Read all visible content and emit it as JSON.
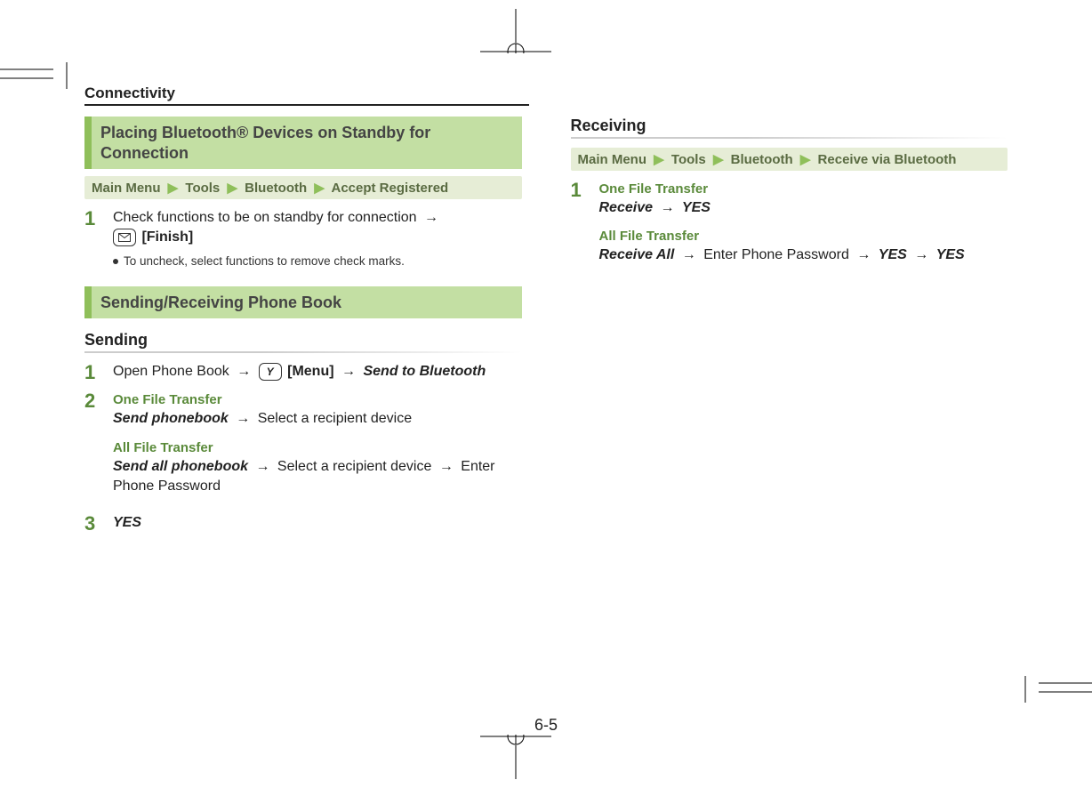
{
  "header": "Connectivity",
  "pageNumber": "6-5",
  "leftCol": {
    "heading1": "Placing Bluetooth® Devices on Standby for Connection",
    "nav1": {
      "root": "Main Menu",
      "items": [
        "Tools",
        "Bluetooth",
        "Accept Registered"
      ]
    },
    "step1": {
      "num": "1",
      "text1": "Check functions to be on standby for connection",
      "finish": "[Finish]",
      "note": "To uncheck, select functions to remove check marks."
    },
    "heading2": "Sending/Receiving Phone Book",
    "sendingTitle": "Sending",
    "sendStep1": {
      "num": "1",
      "text": "Open Phone Book",
      "menuLabel": "[Menu]",
      "sendTo": "Send to Bluetooth"
    },
    "sendStep2": {
      "num": "2",
      "oneFileLabel": "One File Transfer",
      "oneFileAction": "Send phonebook",
      "oneFileRest": "Select a recipient device",
      "allFileLabel": "All File Transfer",
      "allFileAction": "Send all phonebook",
      "allFileRest1": "Select a recipient device",
      "allFileRest2": "Enter Phone Password"
    },
    "sendStep3": {
      "num": "3",
      "yes": "YES"
    }
  },
  "rightCol": {
    "receivingTitle": "Receiving",
    "nav": {
      "root": "Main Menu",
      "items": [
        "Tools",
        "Bluetooth",
        "Receive via Bluetooth"
      ]
    },
    "recvStep1": {
      "num": "1",
      "oneFileLabel": "One File Transfer",
      "oneFileAction": "Receive",
      "oneFileYes": "YES",
      "allFileLabel": "All File Transfer",
      "allFileAction": "Receive All",
      "allFileRest": "Enter Phone Password",
      "allFileYes1": "YES",
      "allFileYes2": "YES"
    }
  },
  "arrow": "→",
  "chev": "▶"
}
